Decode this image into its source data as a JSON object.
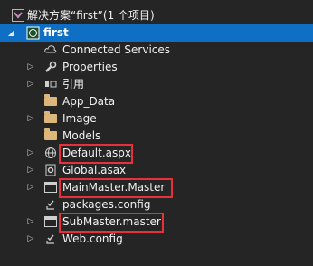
{
  "solution": {
    "label": "解决方案“first”(1 个项目)"
  },
  "project": {
    "label": "first"
  },
  "items": [
    {
      "label": "Connected Services",
      "icon": "cloud-icon"
    },
    {
      "label": "Properties",
      "icon": "wrench-icon"
    },
    {
      "label": "引用",
      "icon": "references-icon"
    },
    {
      "label": "App_Data",
      "icon": "folder-icon"
    },
    {
      "label": "Image",
      "icon": "folder-icon"
    },
    {
      "label": "Models",
      "icon": "folder-icon"
    },
    {
      "label": "Default.aspx",
      "icon": "globe-page-icon"
    },
    {
      "label": "Global.asax",
      "icon": "gear-page-icon"
    },
    {
      "label": "MainMaster.Master",
      "icon": "master-page-icon"
    },
    {
      "label": "packages.config",
      "icon": "config-file-icon"
    },
    {
      "label": "SubMaster.master",
      "icon": "master-page-icon"
    },
    {
      "label": "Web.config",
      "icon": "config-file-icon"
    }
  ],
  "colors": {
    "background": "#252526",
    "selection": "#0e6fc4",
    "highlight_box": "#e8303c",
    "folder": "#dcb67a"
  }
}
